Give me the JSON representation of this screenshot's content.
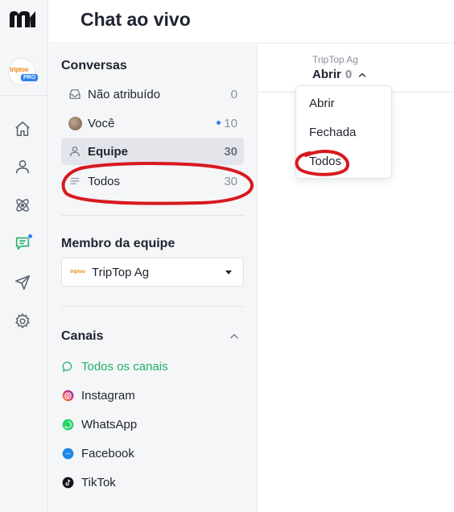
{
  "header": {
    "title": "Chat ao vivo"
  },
  "rail": {
    "brand_text": "triptoo",
    "brand_badge": "PRO",
    "icons": [
      "home-icon",
      "contacts-icon",
      "integrations-icon",
      "chat-icon",
      "send-icon",
      "settings-icon"
    ]
  },
  "conversations": {
    "title": "Conversas",
    "items": [
      {
        "label": "Não atribuído",
        "count": "0",
        "icon": "inbox-icon"
      },
      {
        "label": "Você",
        "count": "10",
        "icon": "avatar"
      },
      {
        "label": "Equipe",
        "count": "30",
        "icon": "user-icon"
      },
      {
        "label": "Todos",
        "count": "30",
        "icon": "list-icon"
      }
    ]
  },
  "team_member": {
    "title": "Membro da equipe",
    "selected": "TripTop Ag",
    "logo_text": "triptoo"
  },
  "channels": {
    "title": "Canais",
    "items": [
      {
        "label": "Todos os canais",
        "icon": "chat-bubble-icon"
      },
      {
        "label": "Instagram",
        "icon": "instagram-icon"
      },
      {
        "label": "WhatsApp",
        "icon": "whatsapp-icon"
      },
      {
        "label": "Facebook",
        "icon": "messenger-icon"
      },
      {
        "label": "TikTok",
        "icon": "tiktok-icon"
      }
    ]
  },
  "main": {
    "inbox_name": "TripTop Ag",
    "status_label": "Abrir",
    "status_count": "0"
  },
  "status_dropdown": {
    "options": [
      "Abrir",
      "Fechada",
      "Todos"
    ]
  },
  "colors": {
    "accent_blue": "#2f80ed",
    "whatsapp_green": "#22b16b",
    "annotation_red": "#d8191f"
  }
}
